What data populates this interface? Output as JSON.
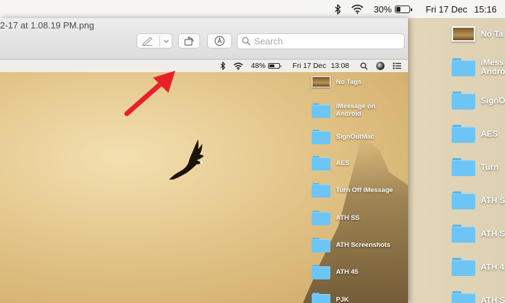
{
  "menubar": {
    "battery_percent": "30%",
    "battery_level": 0.3,
    "date": "Fri 17 Dec",
    "time": "15:16",
    "icons": [
      "bluetooth-icon",
      "wifi-icon",
      "battery-icon"
    ]
  },
  "window": {
    "title": "2-17 at 1.08.19 PM.png",
    "toolbar": {
      "markup_icon": "pen-icon",
      "dropdown_icon": "chevron-down-icon",
      "rotate_icon": "rotate-icon",
      "annotate_icon": "markup-icon",
      "search_placeholder": "Search"
    }
  },
  "screenshot_content": {
    "menubar": {
      "battery_percent": "48%",
      "battery_level": 0.48,
      "date": "Fri 17 Dec",
      "time": "13:08",
      "icons": [
        "bluetooth-icon",
        "wifi-icon",
        "battery-icon",
        "search-icon",
        "siri-icon",
        "control-center-icon"
      ]
    },
    "desktop_items": [
      {
        "label": "No Tags",
        "icon": "image-thumbnail"
      },
      {
        "label": "iMessage on Android",
        "icon": "folder-icon"
      },
      {
        "label": "SignOutMac",
        "icon": "folder-icon"
      },
      {
        "label": "AES",
        "icon": "folder-icon"
      },
      {
        "label": "Turn Off iMessage",
        "icon": "folder-icon"
      },
      {
        "label": "ATH SS",
        "icon": "folder-icon"
      },
      {
        "label": "ATH Screenshots",
        "icon": "folder-icon"
      },
      {
        "label": "ATH 45",
        "icon": "folder-icon"
      },
      {
        "label": "PJK",
        "icon": "folder-icon"
      }
    ]
  },
  "desktop_items": [
    {
      "label": "No Ta",
      "icon": "image-thumbnail"
    },
    {
      "label": "iMess\nAndro",
      "icon": "folder-icon"
    },
    {
      "label": "SignO",
      "icon": "folder-icon"
    },
    {
      "label": "AES",
      "icon": "folder-icon"
    },
    {
      "label": "Turn",
      "icon": "folder-icon"
    },
    {
      "label": "ATH S",
      "icon": "folder-icon"
    },
    {
      "label": "ATH S",
      "icon": "folder-icon"
    },
    {
      "label": "ATH 4",
      "icon": "folder-icon"
    },
    {
      "label": "ATH S",
      "icon": "folder-icon"
    }
  ],
  "colors": {
    "annotation_arrow": "#e8202a",
    "folder_blue": "#6cc5f5"
  }
}
